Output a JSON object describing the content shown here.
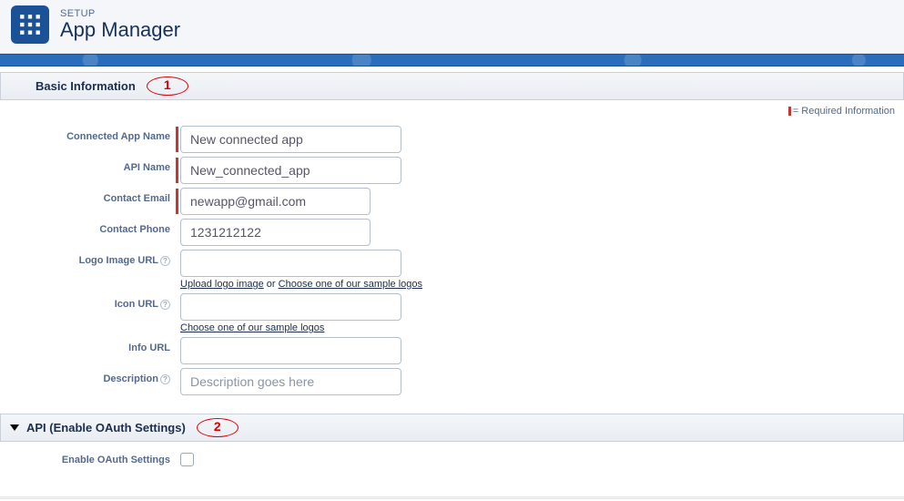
{
  "header": {
    "breadcrumb": "SETUP",
    "title": "App Manager"
  },
  "required_note": "= Required Information",
  "sections": {
    "basic": {
      "title": "Basic Information",
      "callout": "1"
    },
    "api": {
      "title": "API (Enable OAuth Settings)",
      "callout": "2"
    }
  },
  "labels": {
    "connected_app_name": "Connected App Name",
    "api_name": "API Name",
    "contact_email": "Contact Email",
    "contact_phone": "Contact Phone",
    "logo_image_url": "Logo Image URL",
    "icon_url": "Icon URL",
    "info_url": "Info URL",
    "description": "Description",
    "enable_oauth": "Enable OAuth Settings"
  },
  "values": {
    "connected_app_name": "New connected app",
    "api_name": "New_connected_app",
    "contact_email": "newapp@gmail.com",
    "contact_phone": "1231212122",
    "logo_image_url": "",
    "icon_url": "",
    "info_url": "",
    "description": ""
  },
  "placeholders": {
    "description": "Description goes here"
  },
  "hints": {
    "upload_logo": "Upload logo image",
    "or": " or ",
    "choose_sample": "Choose one of our sample logos"
  }
}
